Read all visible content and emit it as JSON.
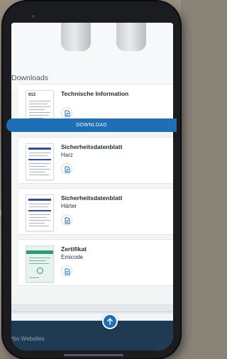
{
  "section": {
    "title": "Downloads"
  },
  "cards": [
    {
      "title": "Technische Information",
      "subtitle": "",
      "thumb_text": "913"
    },
    {
      "title": "Sicherheitsdatenblatt",
      "subtitle": "Harz",
      "thumb_text": ""
    },
    {
      "title": "Sicherheitsdatenblatt",
      "subtitle": "Härter",
      "thumb_text": ""
    },
    {
      "title": "Zertifikat",
      "subtitle": "Emicode",
      "thumb_text": ""
    }
  ],
  "download": {
    "label": "DOWNLOAD"
  },
  "footer": {
    "text": "rbo Websites"
  },
  "icons": {
    "document": "document-icon",
    "scroll_top": "arrow-up-icon"
  },
  "colors": {
    "accent": "#1e6fb5",
    "footer": "#1f3b54"
  }
}
